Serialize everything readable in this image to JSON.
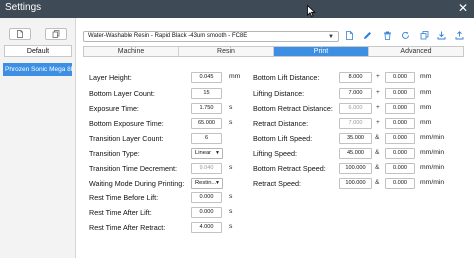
{
  "window": {
    "title": "Settings",
    "close_glyph": "✕"
  },
  "left": {
    "default_label": "Default",
    "printers": [
      "Phrozen Sonic Mega 8K"
    ]
  },
  "profile": {
    "value": "Water-Washable Resin - Rapid Black -43um smooth - FC8E"
  },
  "tabs": [
    {
      "label": "Machine",
      "active": false
    },
    {
      "label": "Resin",
      "active": false
    },
    {
      "label": "Print",
      "active": true
    },
    {
      "label": "Advanced",
      "active": false
    }
  ],
  "left_params": [
    {
      "label": "Layer Height:",
      "value": "0.045",
      "unit": "mm",
      "kind": "input"
    },
    {
      "label": "Bottom Layer Count:",
      "value": "15",
      "unit": "",
      "kind": "input"
    },
    {
      "label": "Exposure Time:",
      "value": "1.750",
      "unit": "s",
      "kind": "input"
    },
    {
      "label": "Bottom Exposure Time:",
      "value": "65.000",
      "unit": "s",
      "kind": "input"
    },
    {
      "label": "Transition Layer Count:",
      "value": "6",
      "unit": "",
      "kind": "input"
    },
    {
      "label": "Transition Type:",
      "value": "Linear",
      "unit": "",
      "kind": "select"
    },
    {
      "label": "Transition Time Decrement:",
      "value": "9.040",
      "unit": "s",
      "kind": "disabled"
    },
    {
      "label": "Waiting Mode During Printing:",
      "value": "Restin...",
      "unit": "",
      "kind": "select"
    },
    {
      "label": "Rest Time Before Lift:",
      "value": "0.000",
      "unit": "s",
      "kind": "input"
    },
    {
      "label": "Rest Time After Lift:",
      "value": "0.000",
      "unit": "s",
      "kind": "input"
    },
    {
      "label": "Rest Time After Retract:",
      "value": "4.000",
      "unit": "s",
      "kind": "input"
    }
  ],
  "right_params": [
    {
      "label": "Bottom Lift Distance:",
      "v1": "8.000",
      "sep": "+",
      "v2": "0.000",
      "unit": "mm",
      "v1_disabled": false
    },
    {
      "label": "Lifting Distance:",
      "v1": "7.000",
      "sep": "+",
      "v2": "0.000",
      "unit": "mm",
      "v1_disabled": false
    },
    {
      "label": "Bottom Retract Distance:",
      "v1": "6.000",
      "sep": "+",
      "v2": "0.000",
      "unit": "mm",
      "v1_disabled": true
    },
    {
      "label": "Retract Distance:",
      "v1": "7.000",
      "sep": "+",
      "v2": "0.000",
      "unit": "mm",
      "v1_disabled": true
    },
    {
      "label": "Bottom Lift Speed:",
      "v1": "35.000",
      "sep": "&",
      "v2": "0.000",
      "unit": "mm/min",
      "v1_disabled": false
    },
    {
      "label": "Lifting Speed:",
      "v1": "45.000",
      "sep": "&",
      "v2": "0.000",
      "unit": "mm/min",
      "v1_disabled": false
    },
    {
      "label": "Bottom Retract Speed:",
      "v1": "100.000",
      "sep": "&",
      "v2": "0.000",
      "unit": "mm/min",
      "v1_disabled": false
    },
    {
      "label": "Retract Speed:",
      "v1": "100.000",
      "sep": "&",
      "v2": "0.000",
      "unit": "mm/min",
      "v1_disabled": false
    }
  ],
  "icons": {
    "left_buttons": [
      "new-file-icon",
      "copy-file-icon"
    ],
    "toolbar": [
      "new-profile-icon",
      "edit-pencil-icon",
      "delete-trash-icon",
      "refresh-icon",
      "duplicate-icon",
      "import-icon",
      "export-icon"
    ]
  },
  "colors": {
    "titlebar": "#3f4a57",
    "accent": "#3c8fe3"
  }
}
